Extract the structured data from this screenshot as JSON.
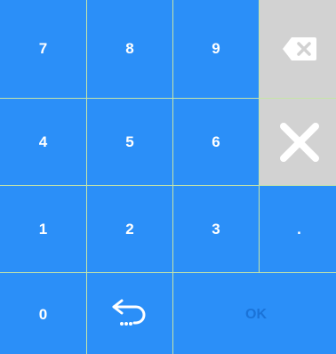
{
  "keys": {
    "k7": "7",
    "k8": "8",
    "k9": "9",
    "k4": "4",
    "k5": "5",
    "k6": "6",
    "k1": "1",
    "k2": "2",
    "k3": "3",
    "dot": ".",
    "k0": "0",
    "ok": "OK"
  },
  "icons": {
    "backspace": "backspace-icon",
    "clear": "close-icon",
    "enter": "return-arrow-icon"
  },
  "colors": {
    "key_blue": "#2b8ff8",
    "key_gray": "#d2d2d2",
    "ok_text": "#1a73d8",
    "grid_line": "#c6e5a8"
  }
}
